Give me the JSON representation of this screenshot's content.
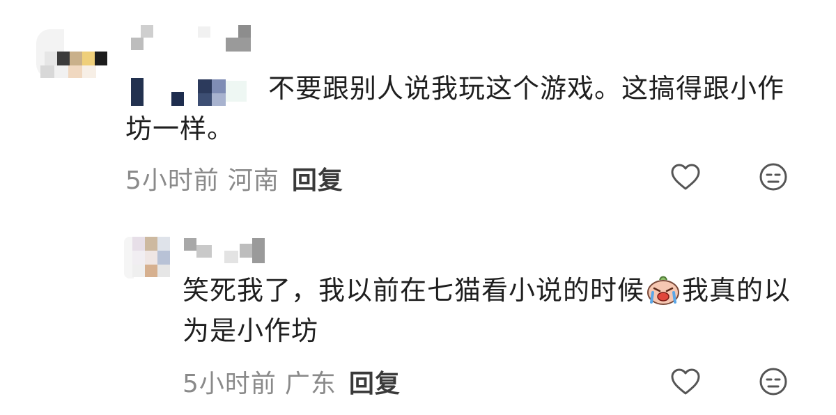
{
  "comments": [
    {
      "text": "不要跟别人说我玩这个游戏。这搞得跟小作坊一样。",
      "time": "5小时前",
      "location": "河南",
      "reply_label": "回复"
    },
    {
      "text_before_emoji": "笑死我了，我以前在七猫看小说的时候",
      "text_after_emoji": "我真的以为是小作坊",
      "time": "5小时前",
      "location": "广东",
      "reply_label": "回复"
    }
  ],
  "icons": {
    "like": "heart-outline-icon",
    "dislike": "neutral-face-icon",
    "emoji": "crying-laughing-sticker-icon"
  },
  "colors": {
    "text": "#1f1f1f",
    "meta": "#8a8a8a",
    "reply": "#3a3a3a",
    "icon": "#555555"
  }
}
